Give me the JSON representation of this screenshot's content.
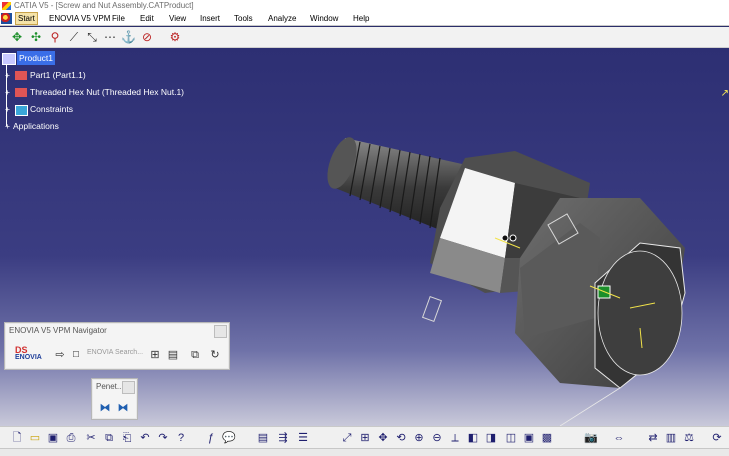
{
  "window": {
    "title": "CATIA V5 - [Screw and Nut Assembly.CATProduct]"
  },
  "menubar": {
    "items": [
      "Start",
      "ENOVIA V5 VPM",
      "File",
      "Edit",
      "View",
      "Insert",
      "Tools",
      "Analyze",
      "Window",
      "Help"
    ],
    "active": "Start"
  },
  "tree": {
    "root": "Product1",
    "children": [
      "Part1 (Part1.1)",
      "Threaded Hex Nut (Threaded Hex Nut.1)",
      "Constraints",
      "Applications"
    ]
  },
  "enovia_navigator": {
    "title": "ENOVIA V5 VPM Navigator",
    "logo_text": "ENOVIA",
    "search_placeholder": "ENOVIA Search..."
  },
  "penetration_panel": {
    "title": "Penet..."
  },
  "colors": {
    "viewport_top": "#2d2f73",
    "viewport_bottom": "#c9c9da",
    "selection": "#3a6ee8",
    "active_menu": "#f5e3a8"
  },
  "toolbar_top_icons": [
    "move-icon",
    "compass-move-icon",
    "snap-icon",
    "manipulate-icon",
    "explode-icon",
    "clash-icon",
    "fix-icon",
    "assembly-constraint-icon",
    "product-icon"
  ],
  "toolbar_bottom_icons": [
    "new-icon",
    "open-icon",
    "save-icon",
    "print-icon",
    "cut-icon",
    "copy-icon",
    "paste-icon",
    "undo-icon",
    "redo-icon",
    "whats-this-icon",
    "formula-icon",
    "comment-icon",
    "catalog-icon",
    "fly-icon",
    "pan-icon",
    "rotate-icon",
    "zoom-in-icon",
    "zoom-out-icon",
    "normal-view-icon",
    "iso-view-icon",
    "shading-icon",
    "hide-show-icon",
    "swap-icon",
    "capture-icon",
    "measure-icon"
  ]
}
